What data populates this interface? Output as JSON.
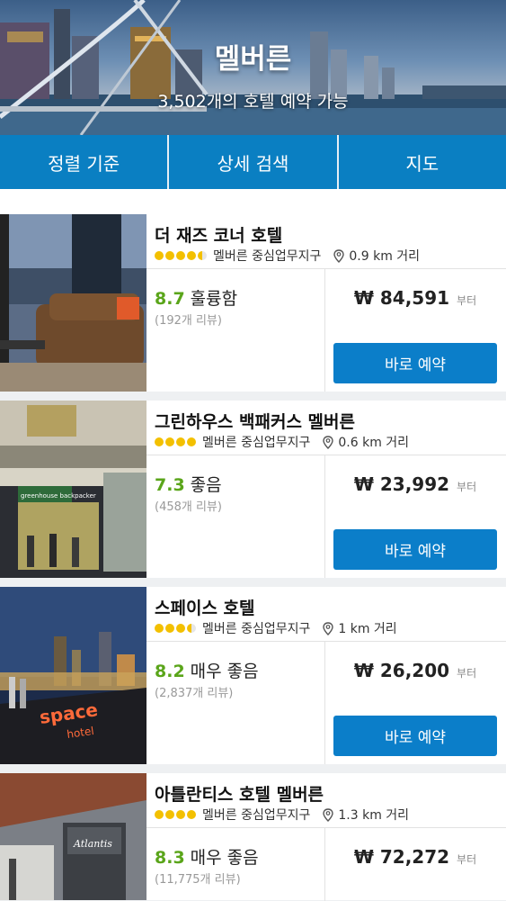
{
  "header": {
    "city": "멜버른",
    "subtitle": "3,502개의 호텔 예약 가능"
  },
  "nav": {
    "sort": "정렬 기준",
    "filter": "상세 검색",
    "map": "지도"
  },
  "colors": {
    "brand_blue": "#0a7fc2",
    "score_green": "#5aa51a",
    "star_yellow": "#f3c000"
  },
  "hotels": [
    {
      "name": "더 재즈 코너 호텔",
      "stars": 4.5,
      "area": "멜버른 중심업무지구",
      "distance": "0.9 km 거리",
      "score": "8.7",
      "rating_word": "훌륭함",
      "reviews": "(192개 리뷰)",
      "price": "₩ 84,591",
      "from": "부터",
      "book": "바로 예약"
    },
    {
      "name": "그린하우스 백패커스 멜버른",
      "stars": 4,
      "area": "멜버른 중심업무지구",
      "distance": "0.6 km 거리",
      "score": "7.3",
      "rating_word": "좋음",
      "reviews": "(458개 리뷰)",
      "price": "₩ 23,992",
      "from": "부터",
      "book": "바로 예약"
    },
    {
      "name": "스페이스 호텔",
      "stars": 3.5,
      "area": "멜버른 중심업무지구",
      "distance": "1 km 거리",
      "score": "8.2",
      "rating_word": "매우 좋음",
      "reviews": "(2,837개 리뷰)",
      "price": "₩ 26,200",
      "from": "부터",
      "book": "바로 예약"
    },
    {
      "name": "아틀란티스 호텔 멜버른",
      "stars": 4,
      "area": "멜버른 중심업무지구",
      "distance": "1.3 km 거리",
      "score": "8.3",
      "rating_word": "매우 좋음",
      "reviews": "(11,775개 리뷰)",
      "price": "₩ 72,272",
      "from": "부터",
      "book": "바로 예약"
    }
  ],
  "photo_signs": {
    "hotel2": "greenhouse backpacker",
    "hotel3_top": "space",
    "hotel3_bottom": "hotel",
    "hotel4": "Atlantis"
  }
}
